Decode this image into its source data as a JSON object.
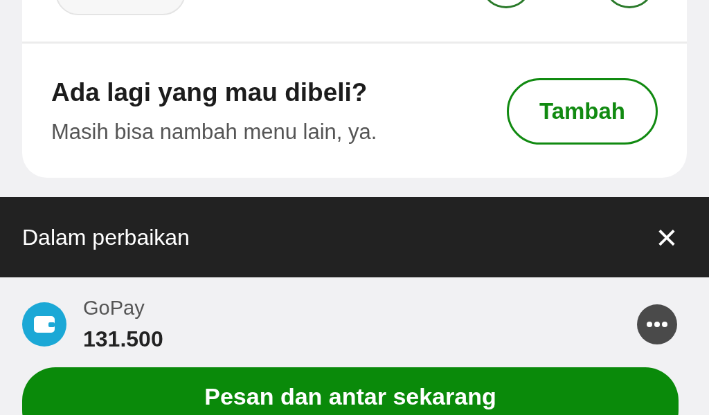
{
  "add_more": {
    "title": "Ada lagi yang mau dibeli?",
    "subtitle": "Masih bisa nambah menu lain, ya.",
    "button": "Tambah"
  },
  "banner": {
    "text": "Dalam perbaikan",
    "close": "×"
  },
  "payment": {
    "method": "GoPay",
    "balance": "131.500"
  },
  "order_button": "Pesan dan antar sekarang"
}
